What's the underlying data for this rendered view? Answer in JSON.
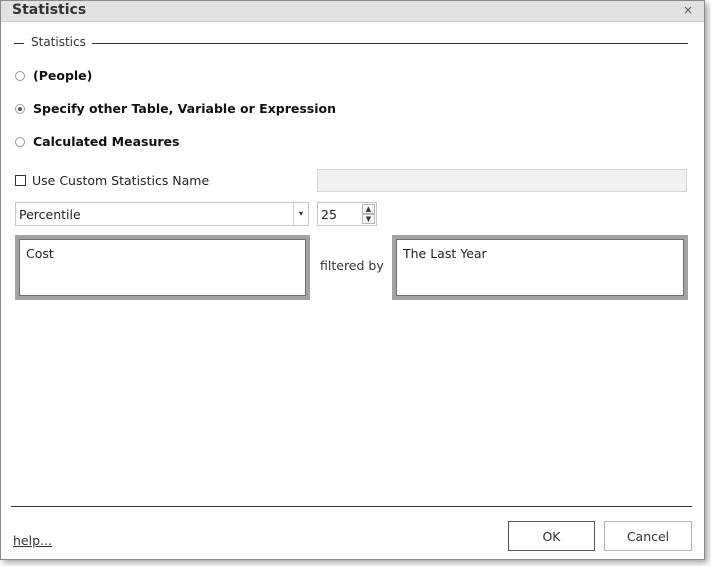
{
  "window": {
    "title": "Statistics",
    "close_glyph": "×"
  },
  "group": {
    "label": "Statistics"
  },
  "radios": [
    {
      "label": "(People)",
      "checked": false
    },
    {
      "label": "Specify other Table, Variable or Expression",
      "checked": true
    },
    {
      "label": "Calculated Measures",
      "checked": false
    }
  ],
  "custom_name": {
    "label": "Use Custom Statistics Name",
    "checked": false,
    "value": ""
  },
  "statistic_select": {
    "value": "Percentile",
    "arrow": "▾"
  },
  "percentile_spinner": {
    "value": "25",
    "up": "▲",
    "down": "▼"
  },
  "measure_well": {
    "text": "Cost"
  },
  "filter_label": "filtered by",
  "filter_well": {
    "text": "The Last Year"
  },
  "footer": {
    "help_link": "help...",
    "ok_label": "OK",
    "cancel_label": "Cancel"
  },
  "colors": {
    "titlebar": "#e2e2e2",
    "well_border": "#a3a3a3",
    "disabled_input": "#f1f1f1"
  }
}
